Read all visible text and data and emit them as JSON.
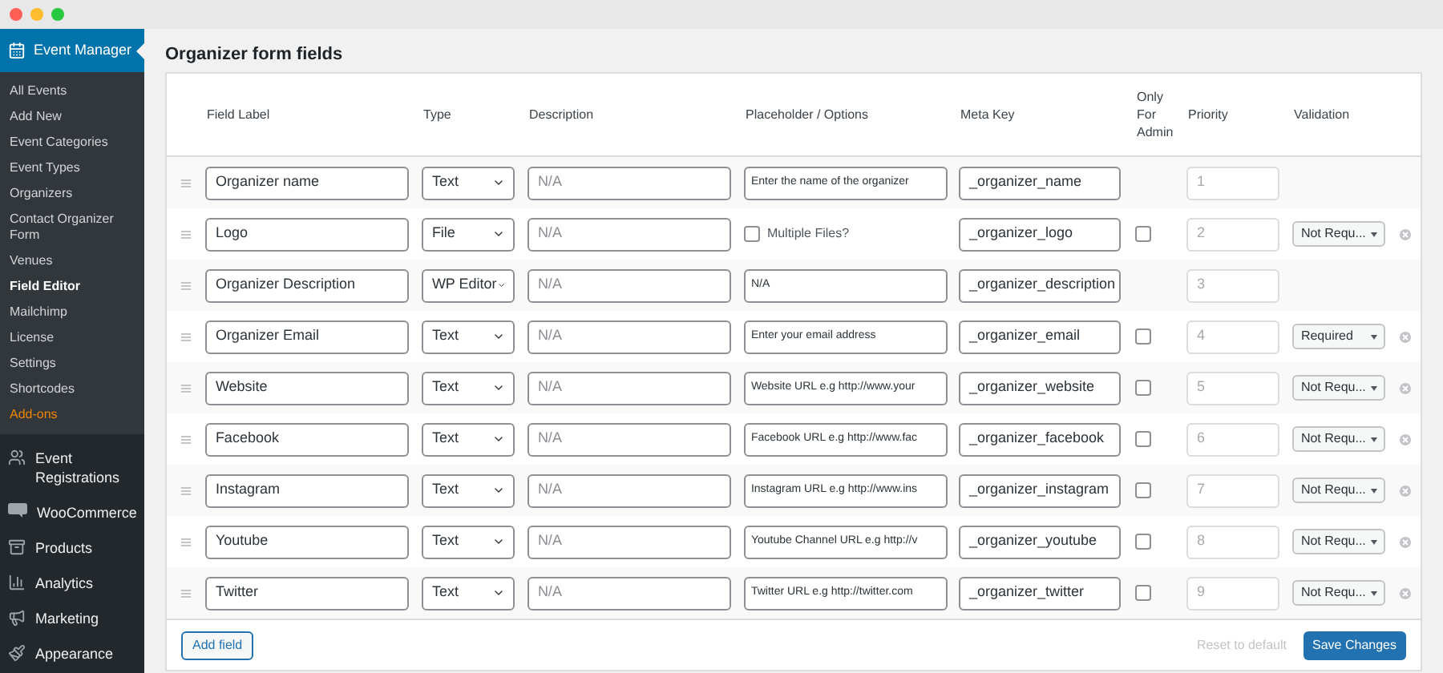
{
  "sidebar": {
    "header": {
      "label": "Event Manager"
    },
    "submenu": [
      {
        "label": "All Events",
        "selected": false,
        "highlight": false
      },
      {
        "label": "Add New",
        "selected": false,
        "highlight": false
      },
      {
        "label": "Event Categories",
        "selected": false,
        "highlight": false
      },
      {
        "label": "Event Types",
        "selected": false,
        "highlight": false
      },
      {
        "label": "Organizers",
        "selected": false,
        "highlight": false
      },
      {
        "label": "Contact Organizer Form",
        "selected": false,
        "highlight": false
      },
      {
        "label": "Venues",
        "selected": false,
        "highlight": false
      },
      {
        "label": "Field Editor",
        "selected": true,
        "highlight": false
      },
      {
        "label": "Mailchimp",
        "selected": false,
        "highlight": false
      },
      {
        "label": "License",
        "selected": false,
        "highlight": false
      },
      {
        "label": "Settings",
        "selected": false,
        "highlight": false
      },
      {
        "label": "Shortcodes",
        "selected": false,
        "highlight": false
      },
      {
        "label": "Add-ons",
        "selected": false,
        "highlight": true
      }
    ],
    "menu": [
      {
        "label": "Event Registrations",
        "kind": "registrations"
      },
      {
        "label": "WooCommerce",
        "kind": "woo"
      },
      {
        "label": "Products",
        "kind": "products"
      },
      {
        "label": "Analytics",
        "kind": "analytics"
      },
      {
        "label": "Marketing",
        "kind": "marketing"
      },
      {
        "label": "Appearance",
        "kind": "appearance"
      }
    ]
  },
  "page": {
    "title": "Organizer form fields"
  },
  "table": {
    "columns": [
      "Field Label",
      "Type",
      "Description",
      "Placeholder / Options",
      "Meta Key",
      "Only For Admin",
      "Priority",
      "Validation"
    ],
    "rows": [
      {
        "label": "Organizer name",
        "type": "Text",
        "description": "N/A",
        "placeholder_options": "Enter the name of the organizer",
        "meta_key": "_organizer_name",
        "priority": "1"
      },
      {
        "label": "Logo",
        "type": "File",
        "description": "N/A",
        "multiple_files": {
          "label": "Multiple Files?",
          "checked": false
        },
        "meta_key": "_organizer_logo",
        "admin_only": {
          "checked": false
        },
        "priority": "2",
        "validation": "Not Requ...",
        "removable": true
      },
      {
        "label": "Organizer Description",
        "type": "WP Editor",
        "description": "N/A",
        "placeholder_options": "N/A",
        "meta_key": "_organizer_description",
        "priority": "3"
      },
      {
        "label": "Organizer Email",
        "type": "Text",
        "description": "N/A",
        "placeholder_options": "Enter your email address",
        "meta_key": "_organizer_email",
        "admin_only": {
          "checked": false
        },
        "priority": "4",
        "validation": "Required",
        "removable": true
      },
      {
        "label": "Website",
        "type": "Text",
        "description": "N/A",
        "placeholder_options": "Website URL e.g http://www.your",
        "meta_key": "_organizer_website",
        "admin_only": {
          "checked": false
        },
        "priority": "5",
        "validation": "Not Requ...",
        "removable": true
      },
      {
        "label": "Facebook",
        "type": "Text",
        "description": "N/A",
        "placeholder_options": "Facebook URL e.g http://www.fac",
        "meta_key": "_organizer_facebook",
        "admin_only": {
          "checked": false
        },
        "priority": "6",
        "validation": "Not Requ...",
        "removable": true
      },
      {
        "label": "Instagram",
        "type": "Text",
        "description": "N/A",
        "placeholder_options": "Instagram URL e.g http://www.ins",
        "meta_key": "_organizer_instagram",
        "admin_only": {
          "checked": false
        },
        "priority": "7",
        "validation": "Not Requ...",
        "removable": true
      },
      {
        "label": "Youtube",
        "type": "Text",
        "description": "N/A",
        "placeholder_options": "Youtube Channel URL e.g http://v",
        "meta_key": "_organizer_youtube",
        "admin_only": {
          "checked": false
        },
        "priority": "8",
        "validation": "Not Requ...",
        "removable": true
      },
      {
        "label": "Twitter",
        "type": "Text",
        "description": "N/A",
        "placeholder_options": "Twitter URL e.g http://twitter.com",
        "meta_key": "_organizer_twitter",
        "admin_only": {
          "checked": false
        },
        "priority": "9",
        "validation": "Not Requ...",
        "removable": true
      }
    ]
  },
  "footer": {
    "add_button": "Add field",
    "reset_link": "Reset to default",
    "save_button": "Save Changes"
  }
}
